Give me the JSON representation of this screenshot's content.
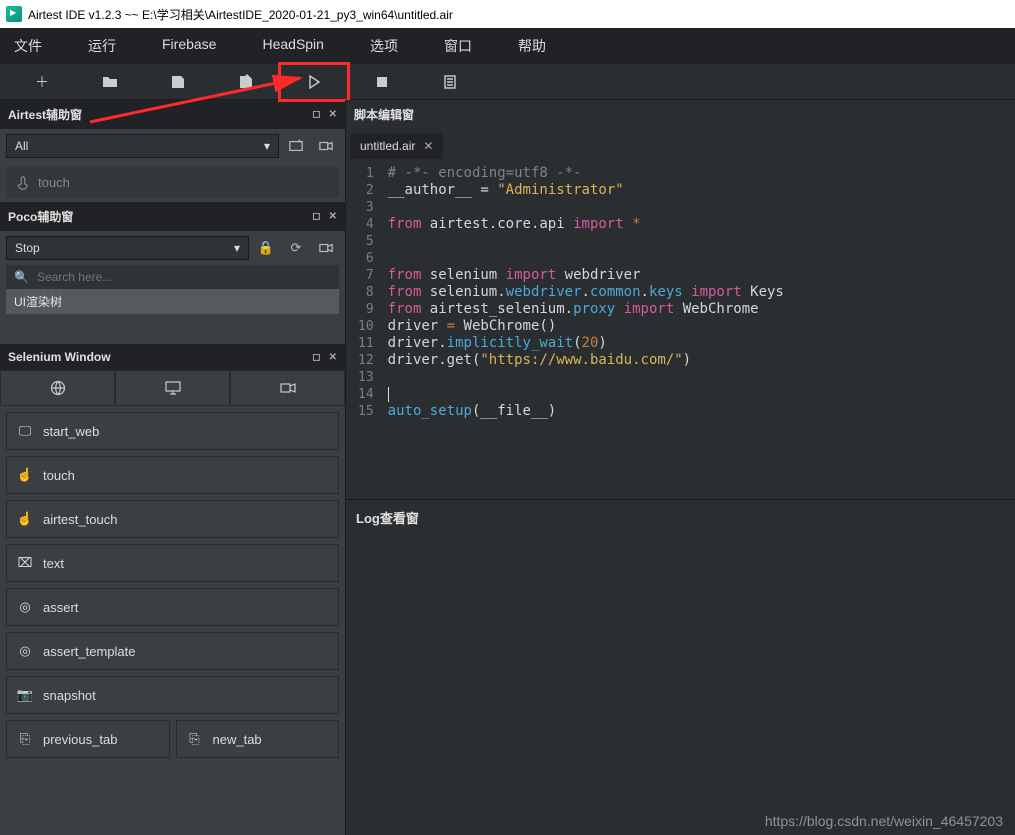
{
  "window": {
    "title": "Airtest IDE v1.2.3 ~~ E:\\学习相关\\AirtestIDE_2020-01-21_py3_win64\\untitled.air"
  },
  "menus": [
    "文件",
    "运行",
    "Firebase",
    "HeadSpin",
    "选项",
    "窗口",
    "帮助"
  ],
  "panels": {
    "airtest_assist": {
      "title": "Airtest辅助窗",
      "dropdown": "All",
      "touch_label": "touch"
    },
    "poco": {
      "title": "Poco辅助窗",
      "dropdown": "Stop",
      "search_placeholder": "Search here...",
      "tree_label": "UI渲染树"
    },
    "selenium": {
      "title": "Selenium Window",
      "cmds": [
        "start_web",
        "touch",
        "airtest_touch",
        "text",
        "assert",
        "assert_template",
        "snapshot"
      ],
      "pair": [
        "previous_tab",
        "new_tab"
      ]
    }
  },
  "editor": {
    "header": "脚本编辑窗",
    "tab": "untitled.air",
    "lines_count": 15
  },
  "code": {
    "l1": "# -*- encoding=utf8 -*-",
    "l2a": "__author__",
    "l2b": " = ",
    "l2c": "\"Administrator\"",
    "l4a": "from",
    "l4b": " airtest.core.api ",
    "l4c": "import",
    "l4d": " *",
    "l7a": "from",
    "l7b": " selenium ",
    "l7c": "import",
    "l7d": " webdriver",
    "l8a": "from",
    "l8b": " selenium.",
    "l8c": "webdriver",
    "l8d": ".",
    "l8e": "common",
    "l8f": ".",
    "l8g": "keys",
    "l8h": " ",
    "l8i": "import",
    "l8j": " Keys",
    "l9a": "from",
    "l9b": " airtest_selenium.",
    "l9c": "proxy",
    "l9d": " ",
    "l9e": "import",
    "l9f": " WebChrome",
    "l10a": "driver ",
    "l10b": "=",
    "l10c": " WebChrome()",
    "l11a": "driver.",
    "l11b": "implicitly_wait",
    "l11c": "(",
    "l11d": "20",
    "l11e": ")",
    "l12a": "driver.get(",
    "l12b": "\"https://www.baidu.com/\"",
    "l12c": ")",
    "l15a": "auto_setup",
    "l15b": "(__file__)"
  },
  "log": {
    "header": "Log查看窗"
  },
  "watermark": "https://blog.csdn.net/weixin_46457203"
}
